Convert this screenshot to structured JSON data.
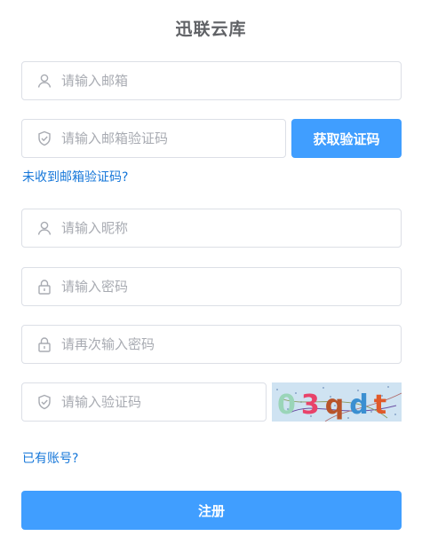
{
  "title": "迅联云库",
  "email": {
    "placeholder": "请输入邮箱",
    "value": "",
    "icon": "user-icon"
  },
  "email_code": {
    "placeholder": "请输入邮箱验证码",
    "value": "",
    "icon": "shield-icon"
  },
  "get_code_button": "获取验证码",
  "no_code_link": "未收到邮箱验证码?",
  "nickname": {
    "placeholder": "请输入昵称",
    "value": "",
    "icon": "user-icon"
  },
  "password": {
    "placeholder": "请输入密码",
    "value": "",
    "icon": "lock-icon"
  },
  "confirm_password": {
    "placeholder": "请再次输入密码",
    "value": "",
    "icon": "lock-icon"
  },
  "captcha": {
    "placeholder": "请输入验证码",
    "value": "",
    "icon": "shield-icon",
    "image_text": "03qdt"
  },
  "have_account_link": "已有账号?",
  "register_button": "注册",
  "colors": {
    "primary": "#409eff",
    "link": "#1677d9",
    "border": "#dcdfe6",
    "placeholder": "#a8abb2"
  }
}
